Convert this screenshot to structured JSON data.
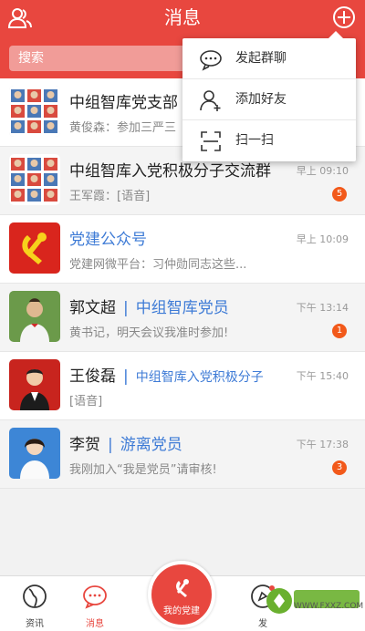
{
  "header": {
    "title": "消息"
  },
  "search": {
    "placeholder": "搜索"
  },
  "popup": {
    "items": [
      {
        "label": "发起群聊",
        "icon": "chat-bubble-icon"
      },
      {
        "label": "添加好友",
        "icon": "add-friend-icon"
      },
      {
        "label": "扫一扫",
        "icon": "scan-icon"
      }
    ]
  },
  "conversations": [
    {
      "name": "中组智库党支部",
      "tag": "",
      "preview": "黄俊森：参加三严三",
      "time": "",
      "badge": "",
      "avatar": "group-photo-grid"
    },
    {
      "name": "中组智库入党积极分子交流群",
      "tag": "",
      "preview": "王军霞：[语音]",
      "time": "早上 09:10",
      "badge": "5",
      "avatar": "group-photo-grid"
    },
    {
      "name": "党建公众号",
      "tag": "",
      "preview": "党建网微平台：习仲勋同志这些...",
      "time": "早上 10:09",
      "badge": "",
      "avatar": "party-emblem"
    },
    {
      "name": "郭文超",
      "tag": "中组智库党员",
      "preview": "黄书记，明天会议我准时参加!",
      "time": "下午 13:14",
      "badge": "1",
      "avatar": "person-photo"
    },
    {
      "name": "王俊磊",
      "tag": "中组智库入党积极分子",
      "preview": "[语音]",
      "time": "下午 15:40",
      "badge": "",
      "avatar": "person-photo"
    },
    {
      "name": "李贺",
      "tag": "游离党员",
      "preview": "我刚加入“我是党员”请审核!",
      "time": "下午 17:38",
      "badge": "3",
      "avatar": "person-photo"
    }
  ],
  "tabbar": {
    "tabs": [
      {
        "label": "资讯",
        "icon": "globe-icon"
      },
      {
        "label": "消息",
        "icon": "message-icon"
      },
      {
        "label": "发",
        "icon": "discover-icon"
      }
    ],
    "center": {
      "label": "我的党建",
      "icon": "party-emblem-icon"
    }
  },
  "colors": {
    "accent": "#e8473f",
    "link": "#3e7bd6",
    "badge": "#f2591a"
  },
  "watermark": {
    "text": "WWW.FXXZ.COM",
    "logo_text": "飞翔下载"
  }
}
